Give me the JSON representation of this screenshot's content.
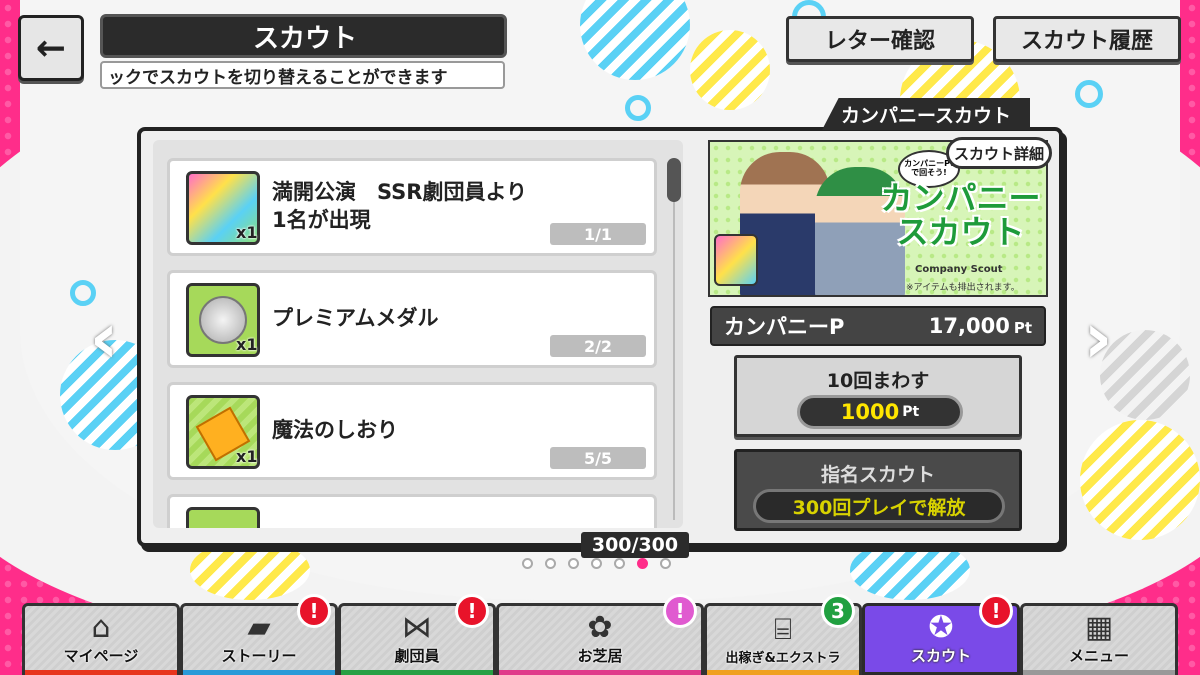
{
  "header": {
    "back_icon": "←",
    "title": "スカウト",
    "subtitle": "ックでスカウトを切り替えることができます",
    "letter_button": "レター確認",
    "history_button": "スカウト履歴"
  },
  "panel": {
    "tab_label": "カンパニースカウト",
    "items": [
      {
        "name_line1": "満開公演　SSR劇団員より",
        "name_line2": "1名が出現",
        "qty": "x1",
        "count": "1/1",
        "icon": "ssr-ticket-icon"
      },
      {
        "name_line1": "プレミアムメダル",
        "name_line2": "",
        "qty": "x1",
        "count": "2/2",
        "icon": "premium-medal-icon"
      },
      {
        "name_line1": "魔法のしおり",
        "name_line2": "",
        "qty": "x1",
        "count": "5/5",
        "icon": "magic-bookmark-icon"
      }
    ],
    "counter": "300/300",
    "page_count": 7,
    "active_page": 6
  },
  "banner": {
    "badge_text": "カンパニーPtで回そう!",
    "title_line1": "カンパニー",
    "title_line2": "スカウト",
    "english": "Company Scout",
    "note": "※アイテムも排出されます。",
    "detail_button": "スカウト詳細"
  },
  "points": {
    "label": "カンパニーP",
    "value": "17,000",
    "unit": "Pt"
  },
  "draw": {
    "label": "10回まわす",
    "cost": "1000",
    "unit": "Pt"
  },
  "nominate": {
    "label": "指名スカウト",
    "condition": "300回プレイで解放"
  },
  "nav": {
    "items": [
      {
        "label": "マイページ",
        "color": "#e8341c"
      },
      {
        "label": "ストーリー",
        "color": "#2a9ad8",
        "badge": "!"
      },
      {
        "label": "劇団員",
        "color": "#28a045",
        "badge": "!"
      },
      {
        "label": "お芝居",
        "color": "#e03a8a",
        "badge": "!"
      },
      {
        "label": "出稼ぎ&エクストラ",
        "color": "#f0a020",
        "badge": "3"
      },
      {
        "label": "スカウト",
        "color": "#7a4ae8",
        "badge": "!"
      },
      {
        "label": "メニュー",
        "color": "#999999"
      }
    ]
  },
  "colors": {
    "accent": "#ff2d8a",
    "active_nav": "#7a4ae8",
    "badge_red": "#e8132a",
    "badge_green": "#20a040",
    "badge_pink": "#e05ad0"
  }
}
